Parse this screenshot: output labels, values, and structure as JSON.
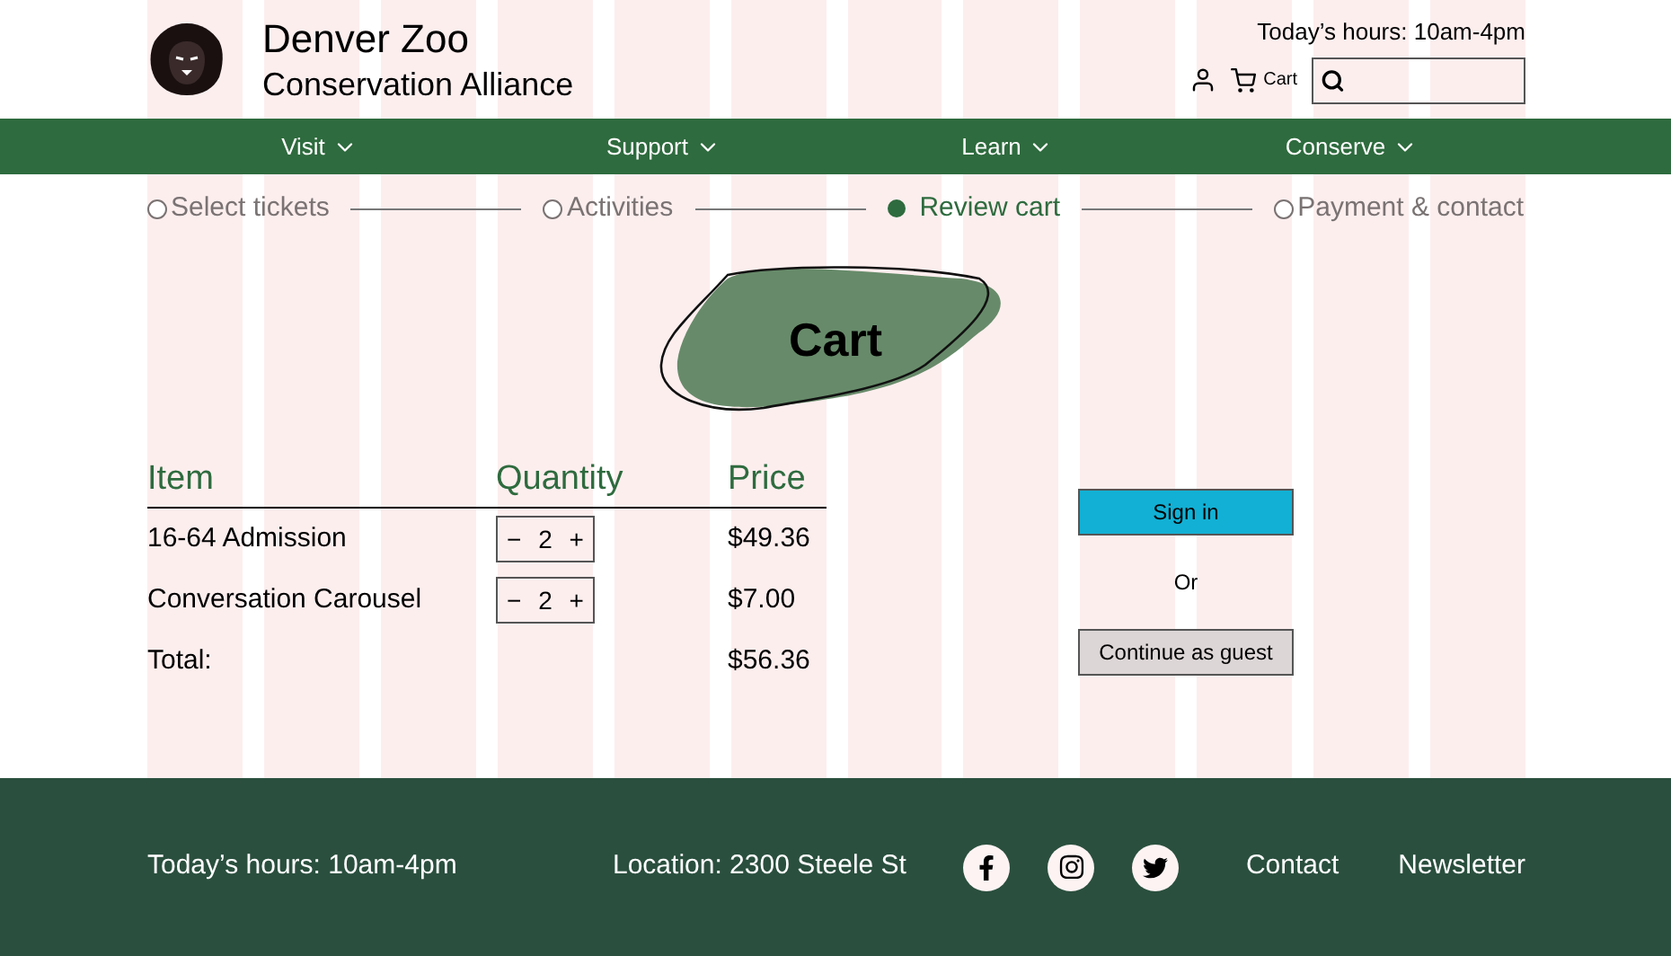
{
  "header": {
    "title": "Denver Zoo",
    "subtitle": "Conservation Alliance",
    "hours": "Today’s hours: 10am-4pm",
    "cart": "Cart"
  },
  "nav": [
    {
      "label": "Visit"
    },
    {
      "label": "Support"
    },
    {
      "label": "Learn"
    },
    {
      "label": "Conserve"
    }
  ],
  "steps": [
    {
      "label": "Select tickets",
      "selected": false
    },
    {
      "label": "Activities",
      "selected": false
    },
    {
      "label": "Review cart",
      "selected": true
    },
    {
      "label": "Payment & contact",
      "selected": false
    }
  ],
  "page_title": "Cart",
  "table": {
    "columns": [
      "Item",
      "Quantity",
      "Price"
    ],
    "rows": [
      {
        "item": "16-64 Admission",
        "decrement": "−",
        "quantity": "2",
        "increment": "+",
        "price": "$49.36"
      },
      {
        "item": "Conversation Carousel",
        "decrement": "−",
        "quantity": "2",
        "increment": "+",
        "price": "$7.00"
      }
    ],
    "total": {
      "label": "Total:",
      "price": "$56.36"
    }
  },
  "auth": {
    "sign_in": "Sign in",
    "or": "Or",
    "guest": "Continue as guest"
  },
  "footer": {
    "hours": "Today’s hours: 10am-4pm",
    "location": "Location: 2300 Steele St",
    "social": [
      {
        "kind": "facebook"
      },
      {
        "kind": "instagram"
      },
      {
        "kind": "twitter"
      }
    ],
    "links": [
      "Contact",
      "Newsletter"
    ]
  }
}
